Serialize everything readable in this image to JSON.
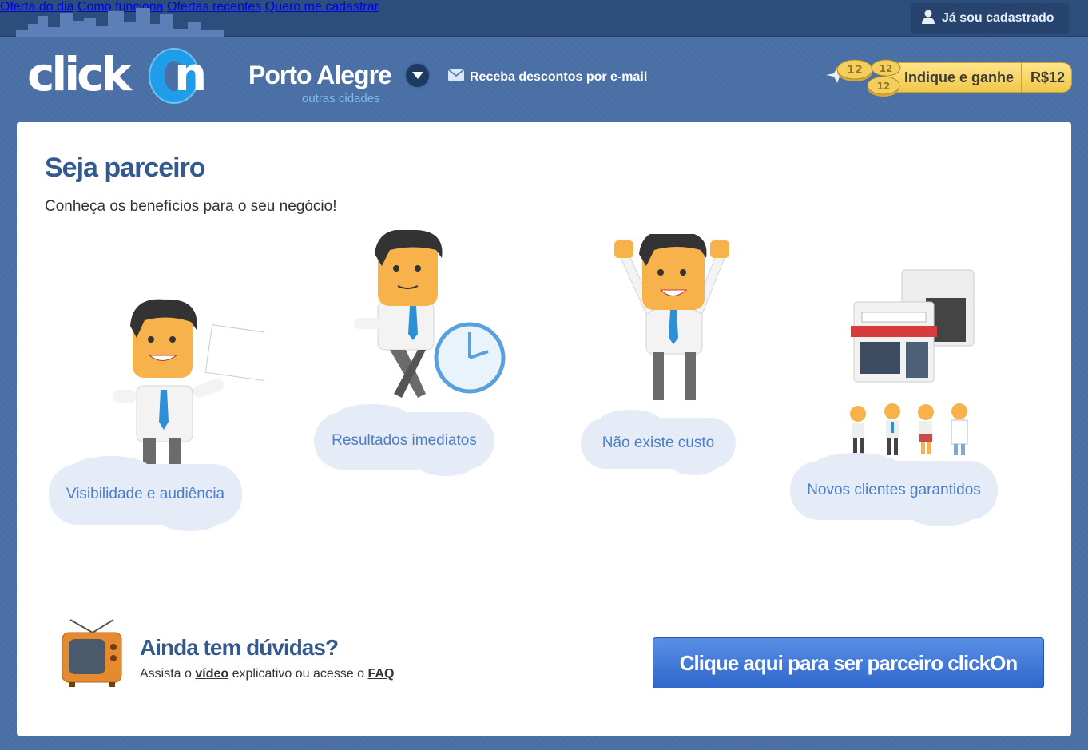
{
  "topnav": {
    "items": [
      "Oferta do dia",
      "Como funciona",
      "Ofertas recentes"
    ],
    "register": "Quero me cadastrar",
    "login": "Já sou cadastrado"
  },
  "header": {
    "logo": "clickOn",
    "city": "Porto Alegre",
    "other_cities": "outras cidades",
    "email_link": "Receba descontos por e-mail",
    "refer_label": "Indique e ganhe",
    "refer_amount": "R$12",
    "coin_value": "12"
  },
  "main": {
    "title": "Seja parceiro",
    "subtitle": "Conheça os benefícios para o seu negócio!",
    "benefits": [
      {
        "label": "Visibilidade e audiência",
        "illustration": "man-holding-sign"
      },
      {
        "label": "Resultados imediatos",
        "illustration": "man-leaning-clock"
      },
      {
        "label": "Não existe custo",
        "illustration": "man-arms-up"
      },
      {
        "label": "Novos clientes garantidos",
        "illustration": "store-and-customers"
      }
    ]
  },
  "footer": {
    "doubts_title": "Ainda tem dúvidas?",
    "doubts_prefix": "Assista o",
    "video_link": "vídeo",
    "doubts_middle": "explicativo ou acesse o",
    "faq_link": "FAQ",
    "cta": "Clique aqui para ser parceiro clickOn"
  },
  "colors": {
    "background": "#4a6fa5",
    "topbar": "#2d4d7c",
    "heading": "#34598e",
    "cloud": "#e5ecf8",
    "cta": "#3a74d6",
    "gold": "#f0c74a"
  }
}
